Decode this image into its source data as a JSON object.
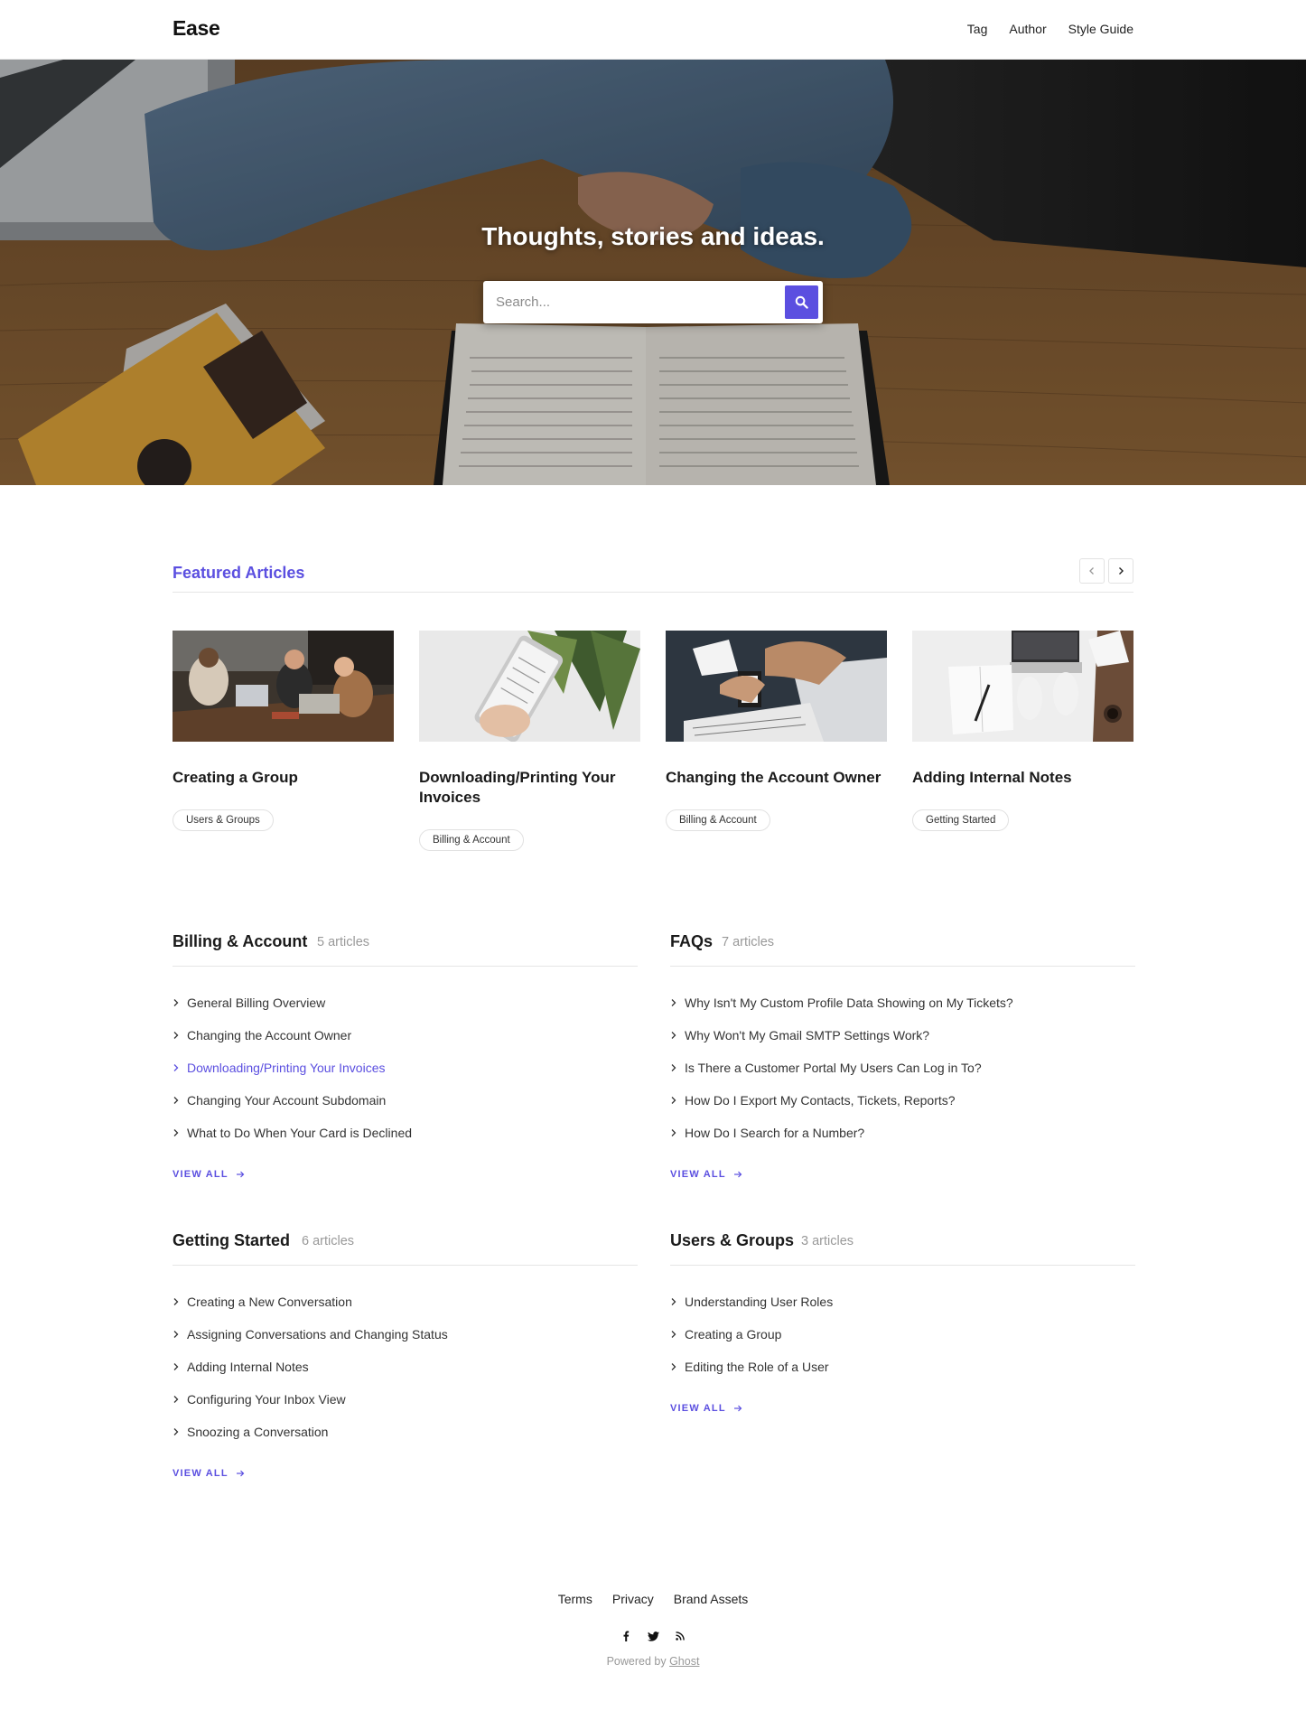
{
  "header": {
    "logo": "Ease",
    "nav": [
      {
        "label": "Tag"
      },
      {
        "label": "Author"
      },
      {
        "label": "Style Guide"
      }
    ]
  },
  "hero": {
    "title": "Thoughts, stories and ideas.",
    "search_placeholder": "Search...",
    "search_icon": "search-icon"
  },
  "featured": {
    "title": "Featured Articles",
    "prev_icon": "chevron-left-icon",
    "next_icon": "chevron-right-icon",
    "cards": [
      {
        "title": "Creating a Group",
        "tag": "Users & Groups"
      },
      {
        "title": "Downloading/Printing Your Invoices",
        "tag": "Billing & Account"
      },
      {
        "title": "Changing the Account Owner",
        "tag": "Billing & Account"
      },
      {
        "title": "Adding Internal Notes",
        "tag": "Getting Started"
      }
    ]
  },
  "topics": [
    {
      "title": "Billing & Account",
      "count": "5 articles",
      "articles": [
        {
          "label": "General Billing Overview"
        },
        {
          "label": "Changing the Account Owner"
        },
        {
          "label": "Downloading/Printing Your Invoices",
          "active": true
        },
        {
          "label": "Changing Your Account Subdomain"
        },
        {
          "label": "What to Do When Your Card is Declined"
        }
      ],
      "view_all": "VIEW ALL"
    },
    {
      "title": "FAQs",
      "count": "7 articles",
      "articles": [
        {
          "label": "Why Isn't My Custom Profile Data Showing on My Tickets?"
        },
        {
          "label": "Why Won't My Gmail SMTP Settings Work?"
        },
        {
          "label": "Is There a Customer Portal My Users Can Log in To?"
        },
        {
          "label": "How Do I Export My Contacts, Tickets, Reports?"
        },
        {
          "label": "How Do I Search for a Number?"
        }
      ],
      "view_all": "VIEW ALL"
    },
    {
      "title": "Getting Started",
      "count": "6 articles",
      "articles": [
        {
          "label": "Creating a New Conversation"
        },
        {
          "label": "Assigning Conversations and Changing Status"
        },
        {
          "label": "Adding Internal Notes"
        },
        {
          "label": "Configuring Your Inbox View"
        },
        {
          "label": "Snoozing a Conversation"
        }
      ],
      "view_all": "VIEW ALL"
    },
    {
      "title": "Users & Groups",
      "count": "3 articles",
      "articles": [
        {
          "label": "Understanding User Roles"
        },
        {
          "label": "Creating a Group"
        },
        {
          "label": "Editing the Role of a User"
        }
      ],
      "view_all": "VIEW ALL"
    }
  ],
  "footer": {
    "links": [
      {
        "label": "Terms"
      },
      {
        "label": "Privacy"
      },
      {
        "label": "Brand Assets"
      }
    ],
    "socials": [
      "facebook-icon",
      "twitter-icon",
      "rss-icon"
    ],
    "powered_prefix": "Powered by ",
    "powered_link": "Ghost"
  },
  "colors": {
    "accent": "#5b4fe0",
    "text": "#1a1a1a",
    "muted": "#999999"
  }
}
